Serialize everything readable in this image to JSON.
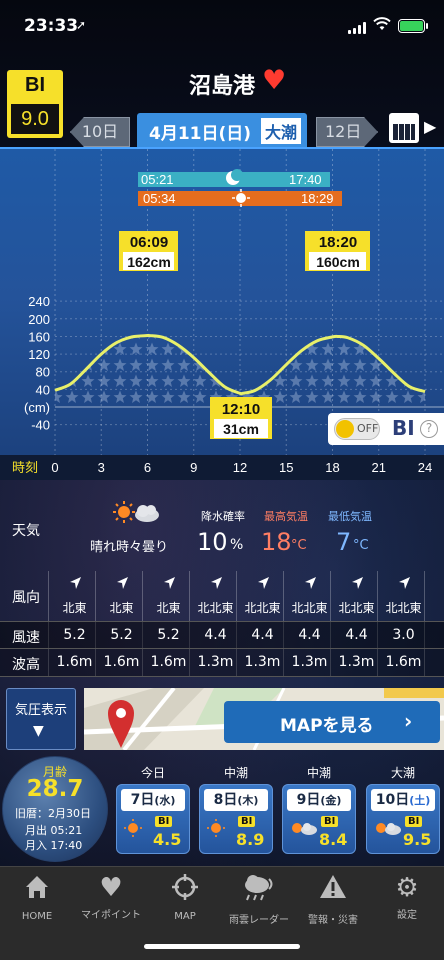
{
  "status_bar": {
    "time": "23:33",
    "location_arrow": "➚"
  },
  "bi_badge": {
    "label": "BI",
    "value": "9.0"
  },
  "port": {
    "name": "沼島港",
    "favorite_icon": "heart-icon"
  },
  "day_nav": {
    "prev": "10日",
    "current_date": "4月11日(日)",
    "tide_type": "大潮",
    "next": "12日"
  },
  "chart": {
    "moon_rise": "05:21",
    "moon_set": "17:40",
    "sun_rise": "05:34",
    "sun_set": "18:29",
    "peaks": [
      {
        "time": "06:09",
        "height": "162cm"
      },
      {
        "time": "18:20",
        "height": "160cm"
      }
    ],
    "low": {
      "time": "12:10",
      "height": "31cm"
    },
    "y_ticks": [
      "240",
      "200",
      "160",
      "120",
      "80",
      "40",
      "(cm)",
      "-40"
    ],
    "time_label": "時刻",
    "x_ticks": [
      "0",
      "3",
      "6",
      "9",
      "12",
      "15",
      "18",
      "21",
      "24"
    ],
    "bi_toggle": {
      "state": "OFF",
      "label": "BI",
      "help": "?"
    }
  },
  "chart_data": {
    "type": "line",
    "title": "",
    "xlabel": "時刻",
    "ylabel": "(cm)",
    "xlim": [
      0,
      24
    ],
    "ylim": [
      -60,
      260
    ],
    "series": [
      {
        "x": [
          0,
          1,
          2,
          3,
          4,
          5,
          6,
          6.15,
          7,
          8,
          9,
          10,
          11,
          12,
          12.17,
          13,
          14,
          15,
          16,
          17,
          18,
          18.33,
          19,
          20,
          21,
          22,
          23,
          24
        ],
        "values": [
          38,
          52,
          85,
          120,
          146,
          159,
          162,
          162,
          158,
          140,
          112,
          78,
          46,
          31,
          31,
          38,
          62,
          96,
          128,
          150,
          159,
          160,
          157,
          140,
          110,
          76,
          46,
          35
        ]
      }
    ]
  },
  "weather": {
    "label": "天気",
    "description": "晴れ時々曇り",
    "rain_title": "降水確率",
    "rain_value": "10",
    "rain_unit": "%",
    "max_title": "最高気温",
    "max_value": "18",
    "max_unit": "°C",
    "min_title": "最低気温",
    "min_value": "7",
    "min_unit": "°C"
  },
  "wind_table": {
    "direction_label": "風向",
    "speed_label": "風速",
    "wave_label": "波高",
    "directions": [
      "北東",
      "北東",
      "北東",
      "北北東",
      "北北東",
      "北北東",
      "北北東",
      "北北東"
    ],
    "speeds": [
      "5.2",
      "5.2",
      "5.2",
      "4.4",
      "4.4",
      "4.4",
      "4.4",
      "3.0"
    ],
    "waves": [
      "1.6m",
      "1.6m",
      "1.6m",
      "1.3m",
      "1.3m",
      "1.3m",
      "1.3m",
      "1.6m"
    ]
  },
  "pressure_button": {
    "label": "気圧表示",
    "arrow": "▼"
  },
  "map_button": {
    "label": "MAPを見る",
    "chevron": "›"
  },
  "moon": {
    "title": "月齢",
    "age": "28.7",
    "lunar_date": "旧暦：2月30日",
    "rise": "月出 05:21",
    "set": "月入 17:40"
  },
  "days": [
    {
      "head": "今日",
      "date": "7日",
      "dow": "(水)",
      "bi_label": "BI",
      "bi": "4.5",
      "weather_icon": "sun-icon"
    },
    {
      "head": "中潮",
      "date": "8日",
      "dow": "(木)",
      "bi_label": "BI",
      "bi": "8.9",
      "weather_icon": "sun-icon"
    },
    {
      "head": "中潮",
      "date": "9日",
      "dow": "(金)",
      "bi_label": "BI",
      "bi": "8.4",
      "weather_icon": "sun-cloud-icon"
    },
    {
      "head": "大潮",
      "date": "10日",
      "dow": "(土)",
      "bi_label": "BI",
      "bi": "9.5",
      "weather_icon": "sun-cloud-icon"
    }
  ],
  "tabbar": [
    {
      "label": "HOME",
      "icon": "home-icon"
    },
    {
      "label": "マイポイント",
      "icon": "heart-icon"
    },
    {
      "label": "MAP",
      "icon": "crosshair-icon"
    },
    {
      "label": "雨雲レーダー",
      "icon": "rain-radar-icon"
    },
    {
      "label": "警報・災害",
      "icon": "warning-icon"
    },
    {
      "label": "設定",
      "icon": "gear-icon"
    }
  ],
  "colors": {
    "accent_yellow": "#f6e02a",
    "tide_line": "#e8f06a",
    "panel_blue": "#1f5aa6",
    "max_temp": "#ff7e63",
    "min_temp": "#7fb8ff",
    "favorite": "#ff3b30"
  }
}
